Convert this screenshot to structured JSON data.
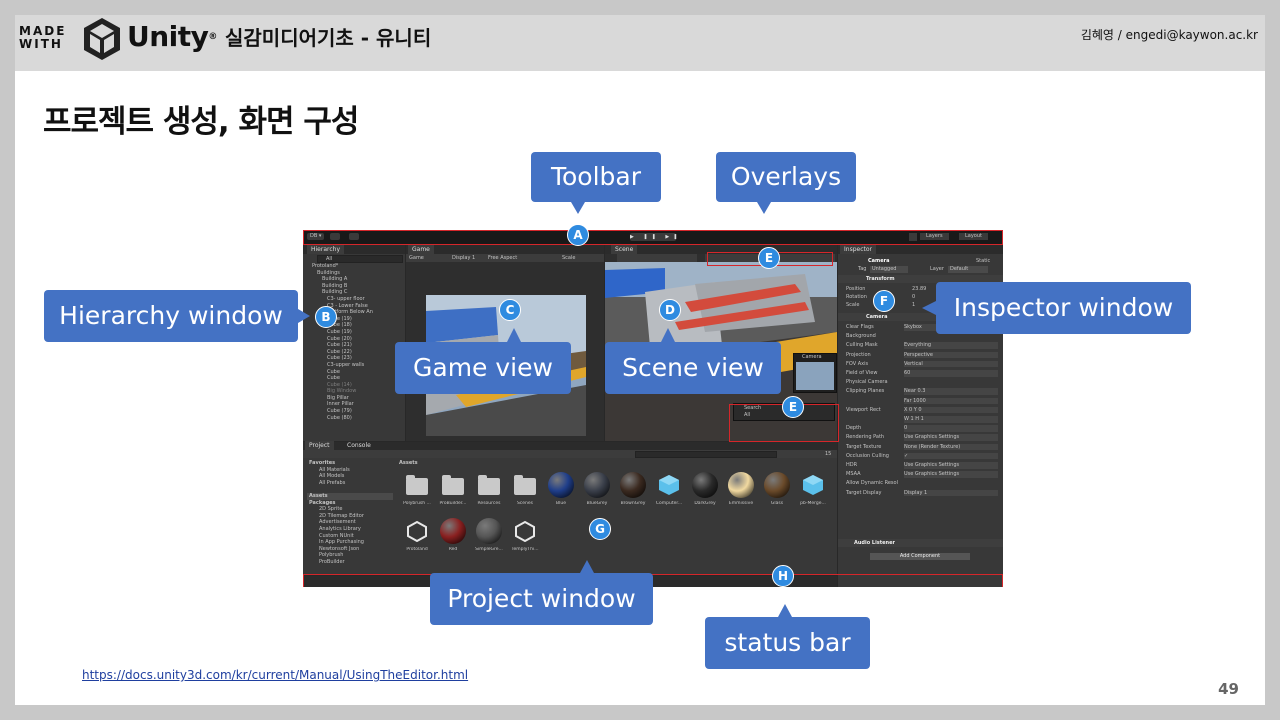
{
  "header": {
    "made_with_line1": "MADE",
    "made_with_line2": "WITH",
    "brand": "Unity",
    "trademark": "®",
    "course_title": "실감미디어기초 - 유니티",
    "author": "김혜영 / engedi@kaywon.ac.kr"
  },
  "page": {
    "heading": "프로젝트 생성, 화면 구성",
    "link": "https://docs.unity3d.com/kr/current/Manual/UsingTheEditor.html",
    "page_number": "49"
  },
  "callouts": {
    "toolbar": "Toolbar",
    "overlays": "Overlays",
    "hierarchy": "Hierarchy window",
    "game": "Game view",
    "scene": "Scene view",
    "inspector": "Inspector window",
    "project": "Project window",
    "status": "status bar"
  },
  "markers": {
    "a": "A",
    "b": "B",
    "c": "C",
    "d": "D",
    "e1": "E",
    "e2": "E",
    "f": "F",
    "g": "G",
    "h": "H"
  },
  "editor": {
    "toolbar": {
      "account": "DB ▾",
      "layers": "Layers",
      "layout": "Layout"
    },
    "hierarchy": {
      "tab": "Hierarchy",
      "search": "All",
      "items": [
        "Protoland*",
        "Buildings",
        "Building A",
        "Building B",
        "Building C",
        "C3- upper floor",
        "C3 - Lower False",
        "Platform Below An",
        "Cube (19)",
        "Cube (18)",
        "Cube (19)",
        "Cube (20)",
        "Cube (21)",
        "Cube (22)",
        "Cube (23)",
        "C3-upper walls",
        "Cube",
        "Cube",
        "Cube (14)",
        "Big Window",
        "Big Pillar",
        "Inner Pillar",
        "Cube (79)",
        "Cube (80)"
      ]
    },
    "game": {
      "tab": "Game",
      "display": "Game",
      "display1": "Display 1",
      "aspect": "Free Aspect",
      "scale": "Scale"
    },
    "scene": {
      "tab": "Scene",
      "camera_label": "Camera",
      "search_label": "Search",
      "search_field": "All",
      "tool_settings": "Tool Settings",
      "pivot": "Center",
      "space": "Local"
    },
    "inspector": {
      "tab": "Inspector",
      "object_name": "Camera",
      "static": "Static",
      "tag_label": "Tag",
      "tag_value": "Untagged",
      "layer_label": "Layer",
      "layer_value": "Default",
      "transform": "Transform",
      "position": "Position",
      "rotation": "Rotation",
      "scale": "Scale",
      "pos_x": "23.89",
      "rot_x": "0",
      "scale_x": "1",
      "camera": "Camera",
      "rows": [
        {
          "label": "Clear Flags",
          "value": "Skybox"
        },
        {
          "label": "Background",
          "value": ""
        },
        {
          "label": "Culling Mask",
          "value": "Everything"
        },
        {
          "label": "Projection",
          "value": "Perspective"
        },
        {
          "label": "FOV Axis",
          "value": "Vertical"
        },
        {
          "label": "Field of View",
          "value": "60"
        },
        {
          "label": "Physical Camera",
          "value": ""
        },
        {
          "label": "Clipping Planes",
          "value": "Near  0.3"
        },
        {
          "label": "",
          "value": "Far   1000"
        },
        {
          "label": "Viewport Rect",
          "value": "X 0   Y 0"
        },
        {
          "label": "",
          "value": "W 1   H 1"
        },
        {
          "label": "Depth",
          "value": "0"
        },
        {
          "label": "Rendering Path",
          "value": "Use Graphics Settings"
        },
        {
          "label": "Target Texture",
          "value": "None (Render Texture)"
        },
        {
          "label": "Occlusion Culling",
          "value": "✓"
        },
        {
          "label": "HDR",
          "value": "Use Graphics Settings"
        },
        {
          "label": "MSAA",
          "value": "Use Graphics Settings"
        },
        {
          "label": "Allow Dynamic Resol",
          "value": ""
        },
        {
          "label": "Target Display",
          "value": "Display 1"
        }
      ],
      "audio_listener": "Audio Listener",
      "add_component": "Add Component"
    },
    "project": {
      "tab_project": "Project",
      "tab_console": "Console",
      "assets_header": "Assets",
      "sidebar": [
        "Favorites",
        "All Materials",
        "All Models",
        "All Prefabs",
        "",
        "Assets",
        "Packages",
        "2D Sprite",
        "2D Tilemap Editor",
        "Advertisement",
        "Analytics Library",
        "Custom NUnit",
        "In App Purchasing",
        "Newtonsoft Json",
        "Polybrush",
        "ProBuilder"
      ],
      "assets_row1": [
        "Polybrush ...",
        "ProBuilder...",
        "Resources",
        "Scenes",
        "Blue",
        "BlueGrey",
        "BrownGrey",
        "Computer...",
        "DarkGrey",
        "Emmissive",
        "Glass",
        "pb-Merge..."
      ],
      "assets_row2": [
        "Protoland",
        "Red",
        "SimpleGre...",
        "TemplyThi..."
      ],
      "count": "15"
    }
  },
  "colors": {
    "callout": "#4472c4",
    "marker": "#2f8be0",
    "highlight": "#d6262a",
    "editor_bg": "#282828",
    "header_bg": "#d9d9d9"
  }
}
